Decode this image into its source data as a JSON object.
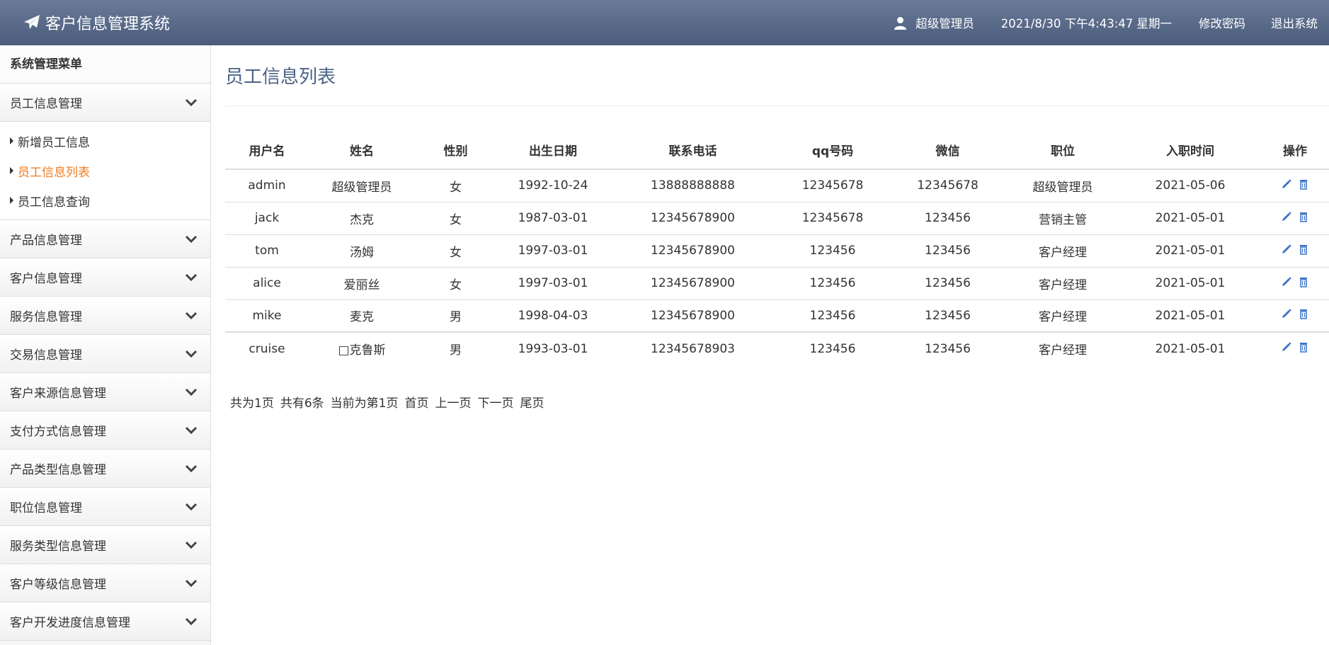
{
  "app": {
    "title": "客户信息管理系统",
    "user_name": "超级管理员",
    "datetime": "2021/8/30 下午4:43:47 星期一",
    "change_password": "修改密码",
    "logout": "退出系统"
  },
  "sidebar": {
    "title": "系统管理菜单",
    "groups": [
      {
        "label": "员工信息管理",
        "expanded": true,
        "items": [
          {
            "label": "新增员工信息"
          },
          {
            "label": "员工信息列表",
            "active": true
          },
          {
            "label": "员工信息查询"
          }
        ]
      },
      {
        "label": "产品信息管理"
      },
      {
        "label": "客户信息管理"
      },
      {
        "label": "服务信息管理"
      },
      {
        "label": "交易信息管理"
      },
      {
        "label": "客户来源信息管理"
      },
      {
        "label": "支付方式信息管理"
      },
      {
        "label": "产品类型信息管理"
      },
      {
        "label": "职位信息管理"
      },
      {
        "label": "服务类型信息管理"
      },
      {
        "label": "客户等级信息管理"
      },
      {
        "label": "客户开发进度信息管理"
      }
    ]
  },
  "main": {
    "title": "员工信息列表",
    "columns": [
      "用户名",
      "姓名",
      "性别",
      "出生日期",
      "联系电话",
      "qq号码",
      "微信",
      "职位",
      "入职时间",
      "操作"
    ],
    "rows": [
      [
        "admin",
        "超级管理员",
        "女",
        "1992-10-24",
        "13888888888",
        "12345678",
        "12345678",
        "超级管理员",
        "2021-05-06"
      ],
      [
        "jack",
        "杰克",
        "女",
        "1987-03-01",
        "12345678900",
        "12345678",
        "123456",
        "营销主管",
        "2021-05-01"
      ],
      [
        "tom",
        "汤姆",
        "女",
        "1997-03-01",
        "12345678900",
        "123456",
        "123456",
        "客户经理",
        "2021-05-01"
      ],
      [
        "alice",
        "爱丽丝",
        "女",
        "1997-03-01",
        "12345678900",
        "123456",
        "123456",
        "客户经理",
        "2021-05-01"
      ],
      [
        "mike",
        "麦克",
        "男",
        "1998-04-03",
        "12345678900",
        "123456",
        "123456",
        "客户经理",
        "2021-05-01"
      ],
      [
        "cruise",
        "□克鲁斯",
        "男",
        "1993-03-01",
        "12345678903",
        "123456",
        "123456",
        "客户经理",
        "2021-05-01"
      ]
    ],
    "pager": {
      "total_pages": "共为1页",
      "total_records": "共有6条",
      "current_page": "当前为第1页",
      "first": "首页",
      "prev": "上一页",
      "next": "下一页",
      "last": "尾页"
    }
  },
  "colors": {
    "topbar": "#5a6a8a",
    "active_menu": "#f07c20",
    "title": "#4a6286",
    "icon_blue": "#3a72c4"
  }
}
